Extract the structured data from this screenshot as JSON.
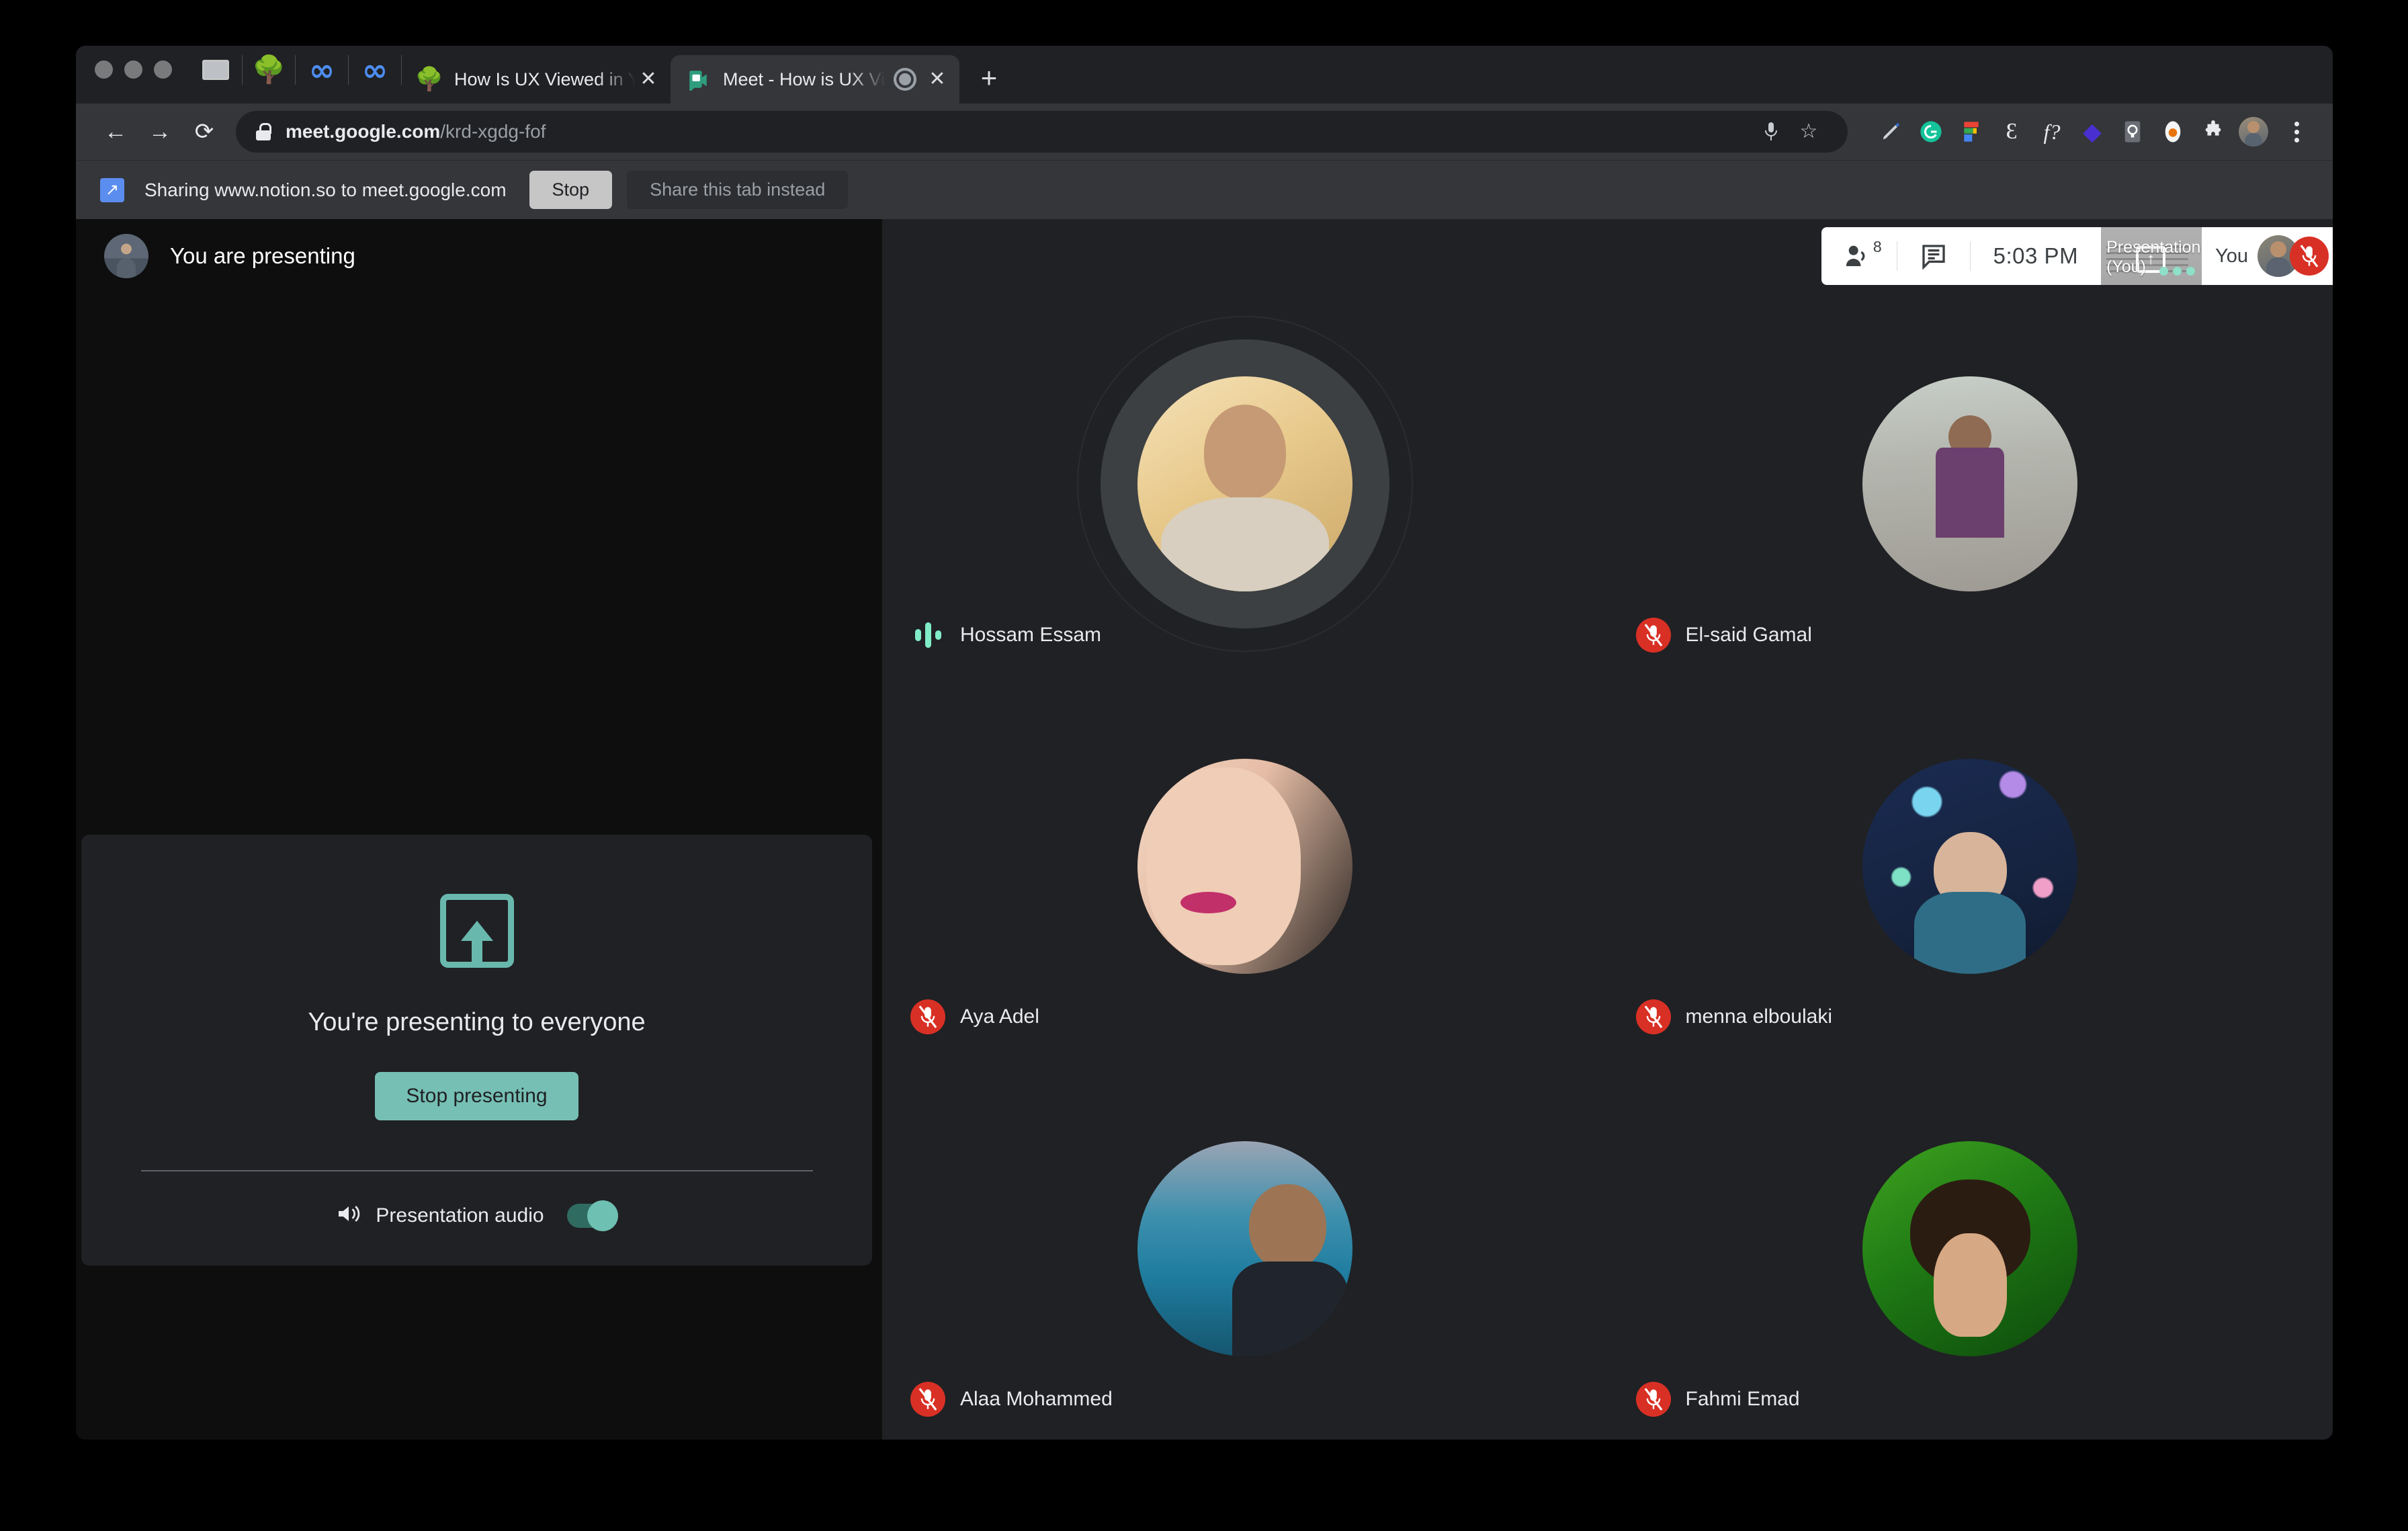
{
  "browser": {
    "pinned_tabs": [
      {
        "name": "window-pin",
        "icon": "window-icon"
      },
      {
        "name": "tree-pin-1",
        "icon": "tree-icon"
      },
      {
        "name": "loop-pin-1",
        "icon": "infinity-icon"
      },
      {
        "name": "loop-pin-2",
        "icon": "infinity-icon"
      },
      {
        "name": "tree-pin-2",
        "icon": "tree-icon"
      }
    ],
    "tabs": [
      {
        "title": "How Is UX Viewed in Your Orga",
        "favicon": "tree-icon",
        "active": false,
        "recording": false
      },
      {
        "title": "Meet - How is UX Viewed i",
        "favicon": "meet-icon",
        "active": true,
        "recording": true
      }
    ],
    "new_tab_label": "+",
    "nav": {
      "back": "←",
      "forward": "→",
      "reload": "⟳"
    },
    "omnibox": {
      "url_host": "meet.google.com",
      "url_path": "/krd-xgdg-fof",
      "lock_icon": "lock-icon"
    },
    "omni_actions": [
      {
        "name": "microphone-icon",
        "glyph": "🎙"
      },
      {
        "name": "bookmark-star-icon",
        "glyph": "☆"
      }
    ],
    "extensions": [
      {
        "name": "pen-extension-icon",
        "glyph": "╱"
      },
      {
        "name": "grammarly-extension-icon",
        "glyph": "G"
      },
      {
        "name": "figma-extension-icon",
        "glyph": "F"
      },
      {
        "name": "epsilon-extension-icon",
        "glyph": "Ɛ"
      },
      {
        "name": "fonts-ninja-extension-icon",
        "glyph": "f?"
      },
      {
        "name": "diamond-extension-icon",
        "glyph": "◆"
      },
      {
        "name": "lightbulb-extension-icon",
        "glyph": "ƒ"
      },
      {
        "name": "loom-extension-icon",
        "glyph": "⬮"
      },
      {
        "name": "puzzle-extensions-icon",
        "glyph": "❖"
      }
    ],
    "profile_icon": "profile-avatar",
    "menu_icon": "three-dot-menu-icon"
  },
  "share_bar": {
    "icon": "screen-share-icon",
    "message": "Sharing www.notion.so to meet.google.com",
    "stop_label": "Stop",
    "share_tab_label": "Share this tab instead"
  },
  "meet": {
    "topbar": {
      "presenting_text": "You are presenting",
      "presenting_avatar": "user-avatar",
      "people_icon": "people-icon",
      "people_count": "8",
      "chat_icon": "chat-icon",
      "time": "5:03 PM",
      "presentation_thumb_label": "Presentation (You)",
      "presentation_thumb_icon": "present-screen-icon",
      "you_thumb_label": "You",
      "you_thumb_avatar": "user-avatar",
      "you_mic_icon": "mic-off-icon"
    },
    "present_card": {
      "icon": "present-screen-icon",
      "title": "You're presenting to everyone",
      "stop_label": "Stop presenting",
      "audio_icon": "speaker-icon",
      "audio_label": "Presentation audio",
      "audio_toggle_on": true
    },
    "participants": [
      {
        "name": "Hossam Essam",
        "muted": false,
        "speaking": true,
        "photo": "ph-hossam"
      },
      {
        "name": "El-said Gamal",
        "muted": true,
        "speaking": false,
        "photo": "ph-elsaid"
      },
      {
        "name": "Aya Adel",
        "muted": true,
        "speaking": false,
        "photo": "ph-aya"
      },
      {
        "name": "menna elboulaki",
        "muted": true,
        "speaking": false,
        "photo": "ph-menna"
      },
      {
        "name": "Alaa Mohammed",
        "muted": true,
        "speaking": false,
        "photo": "ph-alaa"
      },
      {
        "name": "Fahmi Emad",
        "muted": true,
        "speaking": false,
        "photo": "ph-fahmi"
      }
    ]
  },
  "colors": {
    "accent_teal": "#76bfb4",
    "mic_red": "#d93025",
    "speaking_green": "#81ecc8",
    "share_blue": "#5b8def"
  }
}
